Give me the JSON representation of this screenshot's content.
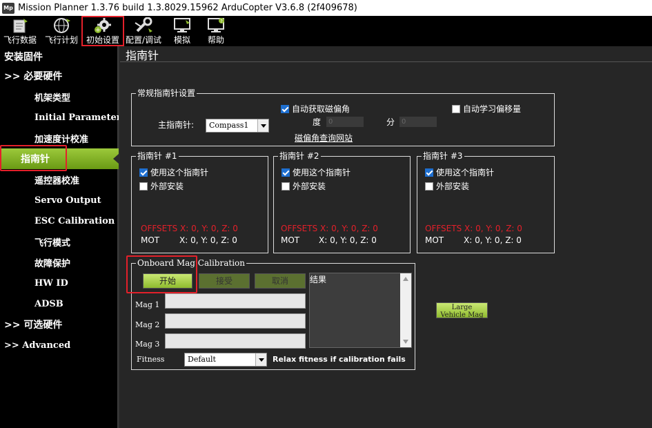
{
  "window": {
    "title": "Mission Planner 1.3.76 build 1.3.8029.15962 ArduCopter V3.6.8 (2f409678)",
    "logo_text": "Mp"
  },
  "toolbar": {
    "items": [
      {
        "label": "飞行数据",
        "icon": "flight-data-icon"
      },
      {
        "label": "飞行计划",
        "icon": "globe-icon"
      },
      {
        "label": "初始设置",
        "icon": "setup-gear-icon"
      },
      {
        "label": "配置/调试",
        "icon": "wrench-icon"
      },
      {
        "label": "模拟",
        "icon": "monitor-icon"
      },
      {
        "label": "帮助",
        "icon": "help-icon"
      }
    ]
  },
  "sidebar": {
    "items": [
      {
        "label": "安装固件"
      },
      {
        "label": ">> 必要硬件"
      },
      {
        "label": "机架类型"
      },
      {
        "label": "Initial Parameters"
      },
      {
        "label": "加速度计校准"
      },
      {
        "label": "指南针"
      },
      {
        "label": "遥控器校准"
      },
      {
        "label": "Servo Output"
      },
      {
        "label": "ESC Calibration"
      },
      {
        "label": "飞行模式"
      },
      {
        "label": "故障保护"
      },
      {
        "label": "HW ID"
      },
      {
        "label": "ADSB"
      },
      {
        "label": ">> 可选硬件"
      },
      {
        "label": ">> Advanced"
      }
    ]
  },
  "page": {
    "title": "指南针"
  },
  "general": {
    "title": "常规指南针设置",
    "primary_label": "主指南针:",
    "primary_value": "Compass1",
    "auto_dec_label": "自动获取磁偏角",
    "auto_learn_label": "自动学习偏移量",
    "degree_label": "度",
    "degree_value": "0",
    "minute_label": "分",
    "minute_value": "0",
    "dec_link": "磁偏角查询网站"
  },
  "compasses": [
    {
      "title": "指南针 #1",
      "use_label": "使用这个指南针",
      "external_label": "外部安装",
      "offsets_text": "OFFSETS  X: 0,   Y: 0,   Z: 0",
      "mot_label": "MOT",
      "mot_values": "X: 0,   Y: 0,   Z: 0"
    },
    {
      "title": "指南针 #2",
      "use_label": "使用这个指南针",
      "external_label": "外部安装",
      "offsets_text": "OFFSETS  X: 0,   Y: 0,   Z: 0",
      "mot_label": "MOT",
      "mot_values": "X: 0,   Y: 0,   Z: 0"
    },
    {
      "title": "指南针 #3",
      "use_label": "使用这个指南针",
      "external_label": "外部安装",
      "offsets_text": "OFFSETS  X: 0,   Y: 0,   Z: 0",
      "mot_label": "MOT",
      "mot_values": "X: 0,   Y: 0,   Z: 0"
    }
  ],
  "onboard": {
    "title": "Onboard Mag Calibration",
    "start_label": "开始",
    "accept_label": "接受",
    "cancel_label": "取消",
    "results_label": "结果",
    "mag1_label": "Mag 1",
    "mag2_label": "Mag 2",
    "mag3_label": "Mag 3",
    "fitness_label": "Fitness",
    "fitness_value": "Default",
    "relax_label": "Relax fitness if calibration fails"
  },
  "large_vehicle": {
    "line1": "Large",
    "line2": "Vehicle Mag"
  }
}
